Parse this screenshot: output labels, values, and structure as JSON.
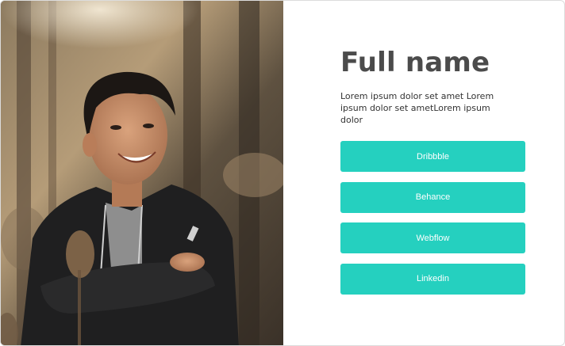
{
  "profile": {
    "name": "Full name",
    "bio": "Lorem ipsum dolor set amet Lorem ipsum dolor set ametLorem ipsum dolor",
    "photo_icon": "portrait-photo"
  },
  "links": [
    {
      "label": "Dribbble"
    },
    {
      "label": "Behance"
    },
    {
      "label": "Webflow"
    },
    {
      "label": "Linkedin"
    }
  ],
  "colors": {
    "accent": "#25d0bf",
    "name_text": "#4b4b4b",
    "body_text": "#333333",
    "background": "#ffffff"
  }
}
